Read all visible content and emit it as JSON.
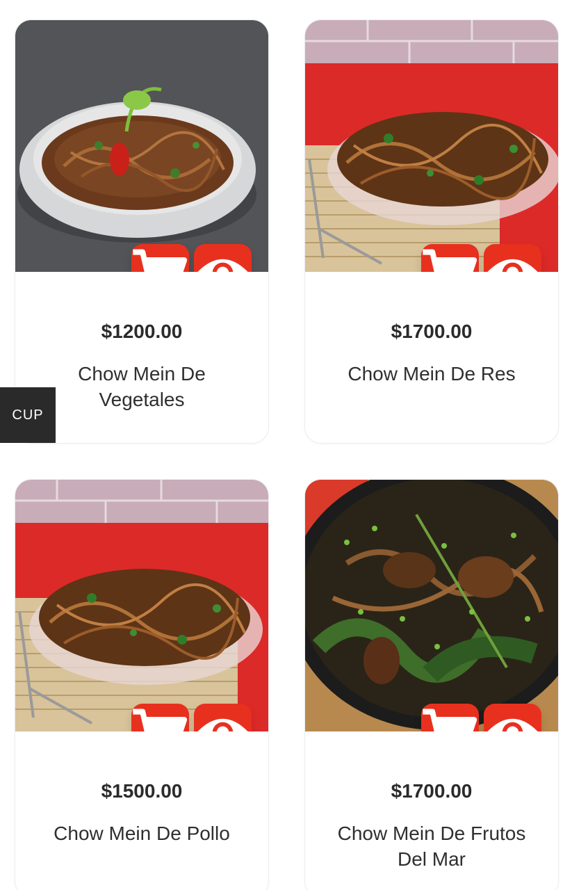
{
  "currency_button": {
    "label": "CUP"
  },
  "colors": {
    "accent": "#e8301f",
    "currency_bg": "#2a2a2a"
  },
  "products": [
    {
      "price": "$1200.00",
      "name": "Chow Mein De Vegetales",
      "cart_icon": "cart-icon",
      "view_icon": "eye-icon"
    },
    {
      "price": "$1700.00",
      "name": "Chow Mein De Res",
      "cart_icon": "cart-icon",
      "view_icon": "eye-icon"
    },
    {
      "price": "$1500.00",
      "name": "Chow Mein De Pollo",
      "cart_icon": "cart-icon",
      "view_icon": "eye-icon"
    },
    {
      "price": "$1700.00",
      "name": "Chow Mein De Frutos Del Mar",
      "cart_icon": "cart-icon",
      "view_icon": "eye-icon"
    }
  ]
}
